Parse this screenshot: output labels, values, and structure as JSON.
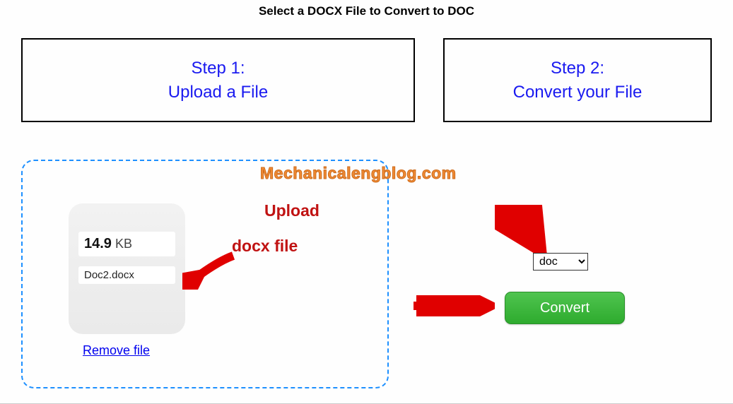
{
  "page_title": "Select a DOCX File to Convert to DOC",
  "steps": {
    "step1": {
      "line1": "Step 1:",
      "line2": "Upload a File"
    },
    "step2": {
      "line1": "Step 2:",
      "line2": "Convert your File"
    }
  },
  "file": {
    "size_value": "14.9",
    "size_unit": " KB",
    "name": "Doc2.docx",
    "remove_label": "Remove file"
  },
  "annotations": {
    "watermark": "Mechanicalengblog.com",
    "upload_line1": "Upload",
    "upload_line2": "docx file"
  },
  "format_select": {
    "selected": "doc"
  },
  "convert_button": "Convert",
  "colors": {
    "step_text": "#1a1af0",
    "dropzone_border": "#1e90ff",
    "annotation_red": "#c01212",
    "watermark_orange": "#f08b35",
    "convert_green": "#2eab2e"
  }
}
